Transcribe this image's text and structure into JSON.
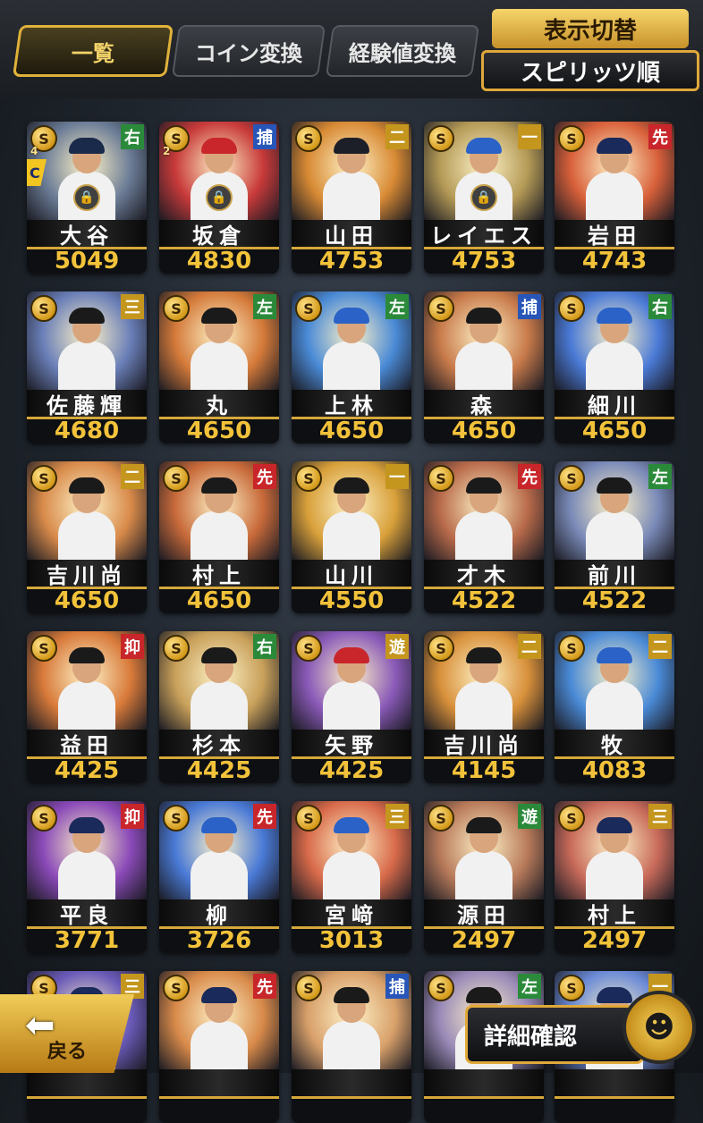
{
  "tabs": [
    {
      "label": "一覧",
      "active": true
    },
    {
      "label": "コイン変換",
      "active": false
    },
    {
      "label": "経験値変換",
      "active": false
    }
  ],
  "display_toggle": {
    "title": "表示切替",
    "sort": "スピリッツ順"
  },
  "coin_symbol": "S",
  "cards": [
    {
      "name": "大谷",
      "score": "5049",
      "position": "右",
      "pos_color": "green",
      "locked": true,
      "limit_break": "4",
      "grade": "C",
      "bg": "#6b7c96",
      "cap": "#1a2a4a"
    },
    {
      "name": "坂倉",
      "score": "4830",
      "position": "捕",
      "pos_color": "blue",
      "locked": true,
      "limit_break": "2",
      "grade": "",
      "bg": "#c83a3a",
      "cap": "#c8262a"
    },
    {
      "name": "山田",
      "score": "4753",
      "position": "二",
      "pos_color": "gold",
      "locked": false,
      "limit_break": "",
      "grade": "",
      "bg": "#d88a34",
      "cap": "#1d1f28"
    },
    {
      "name": "レイエス",
      "score": "4753",
      "position": "一",
      "pos_color": "gold",
      "locked": true,
      "limit_break": "",
      "grade": "",
      "bg": "#b49a56",
      "cap": "#2a62c8"
    },
    {
      "name": "岩田",
      "score": "4743",
      "position": "先",
      "pos_color": "red",
      "locked": false,
      "limit_break": "",
      "grade": "",
      "bg": "#d8603a",
      "cap": "#1a2a5a"
    },
    {
      "name": "佐藤輝",
      "score": "4680",
      "position": "三",
      "pos_color": "gold",
      "locked": false,
      "limit_break": "",
      "grade": "",
      "bg": "#6a7fb8",
      "cap": "#1a1a1a"
    },
    {
      "name": "丸",
      "score": "4650",
      "position": "左",
      "pos_color": "green",
      "locked": false,
      "limit_break": "",
      "grade": "",
      "bg": "#d47a3a",
      "cap": "#1a1a1a"
    },
    {
      "name": "上林",
      "score": "4650",
      "position": "左",
      "pos_color": "green",
      "locked": false,
      "limit_break": "",
      "grade": "",
      "bg": "#4a8ad6",
      "cap": "#2a62c8"
    },
    {
      "name": "森",
      "score": "4650",
      "position": "捕",
      "pos_color": "blue",
      "locked": false,
      "limit_break": "",
      "grade": "",
      "bg": "#c87a4a",
      "cap": "#1a1a1a"
    },
    {
      "name": "細川",
      "score": "4650",
      "position": "右",
      "pos_color": "green",
      "locked": false,
      "limit_break": "",
      "grade": "",
      "bg": "#4a7ad6",
      "cap": "#2a62c8"
    },
    {
      "name": "吉川尚",
      "score": "4650",
      "position": "二",
      "pos_color": "gold",
      "locked": false,
      "limit_break": "",
      "grade": "",
      "bg": "#d88a4a",
      "cap": "#1a1a1a"
    },
    {
      "name": "村上",
      "score": "4650",
      "position": "先",
      "pos_color": "red",
      "locked": false,
      "limit_break": "",
      "grade": "",
      "bg": "#c86a3a",
      "cap": "#1a1a1a"
    },
    {
      "name": "山川",
      "score": "4550",
      "position": "一",
      "pos_color": "gold",
      "locked": false,
      "limit_break": "",
      "grade": "",
      "bg": "#d8a03a",
      "cap": "#1a1a1a"
    },
    {
      "name": "才木",
      "score": "4522",
      "position": "先",
      "pos_color": "red",
      "locked": false,
      "limit_break": "",
      "grade": "",
      "bg": "#b86a4a",
      "cap": "#1a1a1a"
    },
    {
      "name": "前川",
      "score": "4522",
      "position": "左",
      "pos_color": "green",
      "locked": false,
      "limit_break": "",
      "grade": "",
      "bg": "#7a8ab8",
      "cap": "#1a1a1a"
    },
    {
      "name": "益田",
      "score": "4425",
      "position": "抑",
      "pos_color": "red",
      "locked": false,
      "limit_break": "",
      "grade": "",
      "bg": "#d87a3a",
      "cap": "#1a1a1a"
    },
    {
      "name": "杉本",
      "score": "4425",
      "position": "右",
      "pos_color": "green",
      "locked": false,
      "limit_break": "",
      "grade": "",
      "bg": "#c8a05a",
      "cap": "#1a1a1a"
    },
    {
      "name": "矢野",
      "score": "4425",
      "position": "遊",
      "pos_color": "gold",
      "locked": false,
      "limit_break": "",
      "grade": "",
      "bg": "#8a5ab8",
      "cap": "#c8262a"
    },
    {
      "name": "吉川尚",
      "score": "4145",
      "position": "二",
      "pos_color": "gold",
      "locked": false,
      "limit_break": "",
      "grade": "",
      "bg": "#d8903a",
      "cap": "#1a1a1a"
    },
    {
      "name": "牧",
      "score": "4083",
      "position": "二",
      "pos_color": "gold",
      "locked": false,
      "limit_break": "",
      "grade": "",
      "bg": "#4a8ad6",
      "cap": "#2a62c8"
    },
    {
      "name": "平良",
      "score": "3771",
      "position": "抑",
      "pos_color": "red",
      "locked": false,
      "limit_break": "",
      "grade": "",
      "bg": "#8a4ab8",
      "cap": "#1a2a5a"
    },
    {
      "name": "柳",
      "score": "3726",
      "position": "先",
      "pos_color": "red",
      "locked": false,
      "limit_break": "",
      "grade": "",
      "bg": "#4a7ad6",
      "cap": "#2a62c8"
    },
    {
      "name": "宮﨑",
      "score": "3013",
      "position": "三",
      "pos_color": "gold",
      "locked": false,
      "limit_break": "",
      "grade": "",
      "bg": "#d86a4a",
      "cap": "#2a62c8"
    },
    {
      "name": "源田",
      "score": "2497",
      "position": "遊",
      "pos_color": "green",
      "locked": false,
      "limit_break": "",
      "grade": "",
      "bg": "#b87a5a",
      "cap": "#1a1a1a"
    },
    {
      "name": "村上",
      "score": "2497",
      "position": "三",
      "pos_color": "gold",
      "locked": false,
      "limit_break": "",
      "grade": "",
      "bg": "#c86a5a",
      "cap": "#1a2a5a"
    },
    {
      "name": "",
      "score": "",
      "position": "三",
      "pos_color": "gold",
      "locked": false,
      "limit_break": "",
      "grade": "",
      "bg": "#6a5ab8",
      "cap": "#1a2a5a"
    },
    {
      "name": "",
      "score": "",
      "position": "先",
      "pos_color": "red",
      "locked": false,
      "limit_break": "",
      "grade": "",
      "bg": "#d88a4a",
      "cap": "#1a2a5a"
    },
    {
      "name": "",
      "score": "",
      "position": "捕",
      "pos_color": "blue",
      "locked": false,
      "limit_break": "",
      "grade": "",
      "bg": "#d8a06a",
      "cap": "#1a1a1a"
    },
    {
      "name": "",
      "score": "",
      "position": "左",
      "pos_color": "green",
      "locked": false,
      "limit_break": "",
      "grade": "",
      "bg": "#9a8ab8",
      "cap": "#1a1a1a"
    },
    {
      "name": "",
      "score": "",
      "position": "一",
      "pos_color": "gold",
      "locked": false,
      "limit_break": "",
      "grade": "",
      "bg": "#6a8ad6",
      "cap": "#1a2a5a"
    }
  ],
  "footer": {
    "back_label": "戻る",
    "detail_label": "詳細確認"
  }
}
